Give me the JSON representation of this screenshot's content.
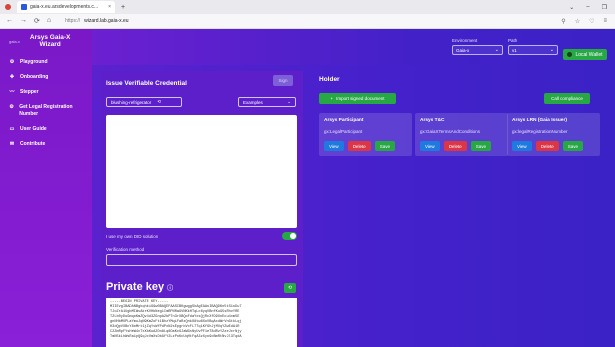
{
  "browser": {
    "tab_title": "gaia-x.eu.arsdevelopments.c...",
    "tab_close": "×",
    "tab_new": "+",
    "window_controls": [
      "⌄",
      "–",
      "❐"
    ],
    "nav": {
      "back": "←",
      "forward": "→",
      "refresh": "⟳",
      "home": "⌂"
    },
    "url_prefix": "https://",
    "url_host": "wizard.lab.gaia-x.eu",
    "right_icons": [
      "⚲",
      "☆",
      "♡",
      "≡"
    ]
  },
  "sidebar": {
    "logo_text": "gaia-x",
    "title_line1": "Arsys Gaia-X",
    "title_line2": "Wizard",
    "items": [
      {
        "icon": "⚙",
        "label": "Playground"
      },
      {
        "icon": "✚",
        "label": "Onboarding"
      },
      {
        "icon": "〰",
        "label": "Stepper"
      },
      {
        "icon": "⚙",
        "label": "Get Legal Registration Number"
      },
      {
        "icon": "▭",
        "label": "User Guide"
      },
      {
        "icon": "✉",
        "label": "Contribute"
      }
    ]
  },
  "topbar": {
    "environment_label": "Environment",
    "environment_value": "Gaia-x",
    "path_label": "Path",
    "path_value": "v1",
    "local_wallet_label": "Local Wallet"
  },
  "issue": {
    "title": "Issue Verifiable Credential",
    "sign_label": "Sign",
    "doc_name": "blushing-refrigerator",
    "doc_icon": "⟲",
    "examples_label": "Examples",
    "own_did_label": "I use my own DID solution",
    "verification_label": "Verification method",
    "private_key_title": "Private key",
    "private_key_btn": "⟲",
    "private_key_text": "-----BEGIN PRIVATE KEY-----\nMIIEvgIBADANBgkqhkiG9w0BAQEFAASCBKgwggSkAgEAAoIBAQDKn5tS1oDu7\nTJoZrA1UgbMIWsAkrKVHbNeg1ImRPNRaGVNKkHTqLc6yqVBnfKuG5sRhvYRE\nT2Lb0yDuGmqoKmZQv4d3ZGnpA2bPTn3rXBQoFdaYxsQjRcXfD9XnEcu4xm5E\ngnNHbMUPLaYmuJqN9KmZoFt1BhzYMqiFaRzQnkO8tw6XoVBqAxdWrVnGtkLqj\nH3dQpVXBcY8oMrt1jZqYvWfPdPxN2sEpgrbVcFL7Tq1KfGhJjMUqYZwEdA1R\nC2ZmRpFYsHeW4vTxXbKuA2Dn8Lq6OaKcGJaWGsNyUvPF1eT8dRzYZzeJcrNjy\nTmN5kLhWsRa1pQ9qJcVmXsDbGfY2LzPoKcUqHtFqA3zXyo9cBmRtNvJl3TqdA"
  },
  "holder": {
    "title": "Holder",
    "import_label": "Import signed document",
    "import_icon": "+",
    "compliance_label": "Call compliance",
    "cards": [
      {
        "title": "Arsys Participant",
        "subtitle": "gx:LegalParticipant",
        "view": "View",
        "delete": "Delete",
        "save": "Save"
      },
      {
        "title": "Arsys T&C",
        "subtitle": "gx:GaiaXTermsAndConditions",
        "view": "View",
        "delete": "Delete",
        "save": "Save"
      },
      {
        "title": "Arsys LRN (Gaia Issuer)",
        "subtitle": "gx:legalRegistrationNumber",
        "view": "View",
        "delete": "Delete",
        "save": "Save"
      }
    ]
  },
  "colors": {
    "sidebar": "#7a18c7",
    "main": "#4521cb",
    "accent_green": "#28a745",
    "view_blue": "#1f7ae0",
    "delete_red": "#dc3545"
  }
}
